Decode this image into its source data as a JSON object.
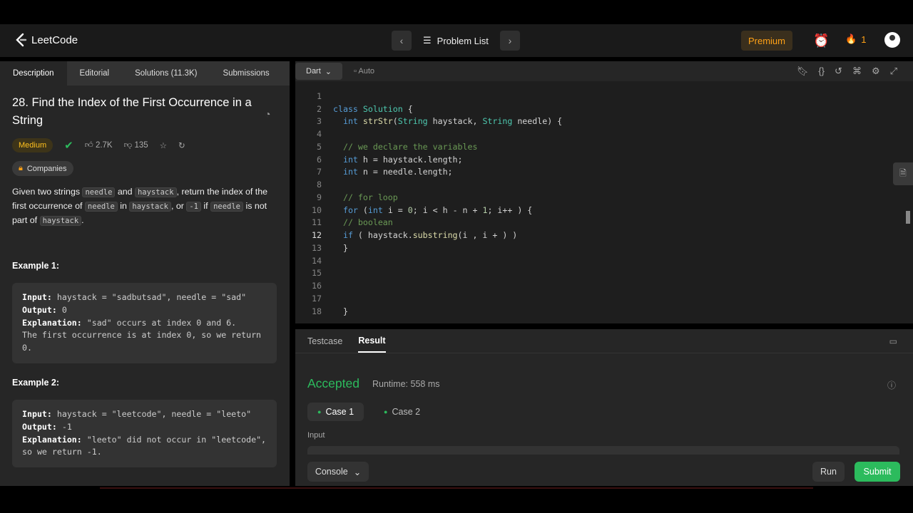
{
  "header": {
    "logo_text": "LeetCode",
    "problem_list": "Problem List",
    "premium": "Premium",
    "streak": "1"
  },
  "left": {
    "tabs": [
      "Description",
      "Editorial",
      "Solutions (11.3K)",
      "Submissions"
    ],
    "title": "28. Find the Index of the First Occurrence in a String",
    "difficulty": "Medium",
    "likes": "2.7K",
    "dislikes": "135",
    "companies": "Companies",
    "description": {
      "t1": "Given two strings ",
      "c1": "needle",
      "t2": " and ",
      "c2": "haystack",
      "t3": ", return the index of the first occurrence of ",
      "c3": "needle",
      "t4": " in ",
      "c4": "haystack",
      "t5": ", or ",
      "c5": "-1",
      "t6": " if ",
      "c6": "needle",
      "t7": " is not part of ",
      "c7": "haystack",
      "t8": "."
    },
    "example1": {
      "heading": "Example 1:",
      "input_label": "Input:",
      "input": " haystack = \"sadbutsad\", needle = \"sad\"",
      "output_label": "Output:",
      "output": " 0",
      "expl_label": "Explanation:",
      "expl": " \"sad\" occurs at index 0 and 6.\nThe first occurrence is at index 0, so we return 0."
    },
    "example2": {
      "heading": "Example 2:",
      "input_label": "Input:",
      "input": " haystack = \"leetcode\", needle = \"leeto\"",
      "output_label": "Output:",
      "output": " -1",
      "expl_label": "Explanation:",
      "expl": " \"leeto\" did not occur in \"leetcode\", so we return -1."
    }
  },
  "editor": {
    "language": "Dart",
    "mode": "Auto",
    "current_line": 12
  },
  "result": {
    "tabs": [
      "Testcase",
      "Result"
    ],
    "status": "Accepted",
    "runtime": "Runtime: 558 ms",
    "cases": [
      "Case 1",
      "Case 2"
    ],
    "input_label": "Input",
    "console": "Console",
    "run": "Run",
    "submit": "Submit"
  }
}
